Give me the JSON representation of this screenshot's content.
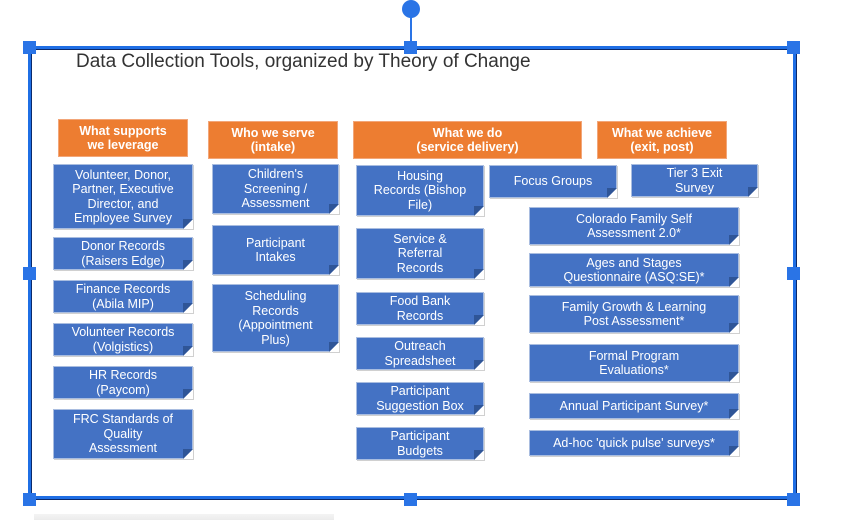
{
  "slide": {
    "title": "Data Collection Tools, organized by Theory of Change"
  },
  "colors": {
    "header_orange": "#ed7d31",
    "box_blue": "#4472c4",
    "selection_blue": "#2a74e6"
  },
  "columns": [
    {
      "header": "What supports\nwe leverage",
      "items": [
        "Volunteer, Donor,\nPartner, Executive\nDirector,  and\nEmployee Survey",
        "Donor Records\n(Raisers Edge)",
        "Finance Records\n(Abila MIP)",
        "Volunteer Records\n(Volgistics)",
        "HR Records\n(Paycom)",
        "FRC Standards of\nQuality\nAssessment"
      ]
    },
    {
      "header": "Who we serve\n(intake)",
      "items": [
        "Children's\nScreening /\nAssessment",
        "Participant\nIntakes",
        "Scheduling\nRecords\n(Appointment\nPlus)"
      ]
    },
    {
      "header": "What we do\n(service delivery)",
      "items": [
        "Housing\nRecords (Bishop\nFile)",
        "Focus Groups",
        "Service &\nReferral\nRecords",
        "Food Bank\nRecords",
        "Outreach\nSpreadsheet",
        "Participant\nSuggestion Box",
        "Participant\nBudgets"
      ]
    },
    {
      "header": "What we achieve\n(exit, post)",
      "items": [
        "Tier 3 Exit\nSurvey",
        "Colorado Family Self\nAssessment 2.0*",
        "Ages and Stages\nQuestionnaire (ASQ:SE)*",
        "Family Growth & Learning\nPost Assessment*",
        "Formal Program\nEvaluations*",
        "Annual Participant Survey*",
        "Ad-hoc 'quick pulse' surveys*"
      ]
    }
  ]
}
